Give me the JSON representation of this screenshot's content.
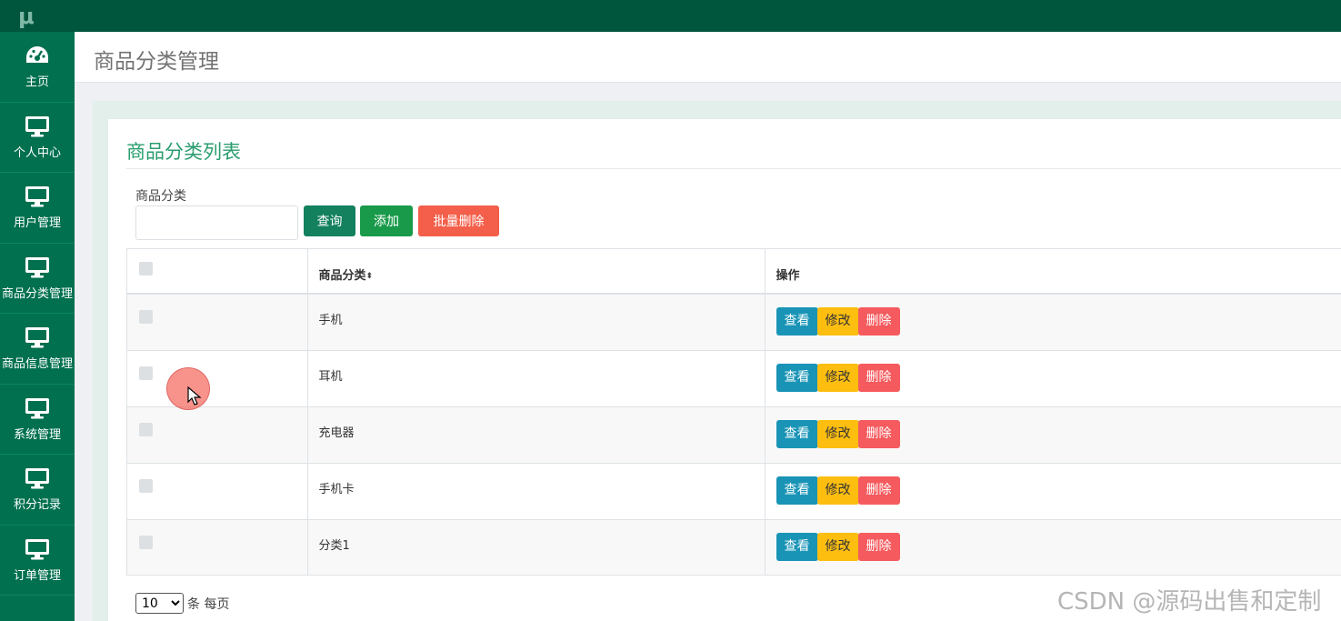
{
  "app": {
    "logo_text": "μ"
  },
  "sidebar": {
    "items": [
      {
        "label": "主页",
        "icon": "dashboard-icon"
      },
      {
        "label": "个人中心",
        "icon": "monitor-icon"
      },
      {
        "label": "用户管理",
        "icon": "monitor-icon"
      },
      {
        "label": "商品分类管理",
        "icon": "monitor-icon"
      },
      {
        "label": "商品信息管理",
        "icon": "monitor-icon"
      },
      {
        "label": "系统管理",
        "icon": "monitor-icon"
      },
      {
        "label": "积分记录",
        "icon": "monitor-icon"
      },
      {
        "label": "订单管理",
        "icon": "monitor-icon"
      }
    ]
  },
  "page": {
    "title": "商品分类管理"
  },
  "card": {
    "title": "商品分类列表"
  },
  "search": {
    "label": "商品分类",
    "value": "",
    "query_label": "查询",
    "add_label": "添加",
    "batch_delete_label": "批量删除"
  },
  "table": {
    "columns": [
      "",
      "商品分类",
      "操作"
    ],
    "sort_icon": "⬍",
    "rows": [
      {
        "category": "手机"
      },
      {
        "category": "耳机"
      },
      {
        "category": "充电器"
      },
      {
        "category": "手机卡"
      },
      {
        "category": "分类1"
      }
    ],
    "actions": {
      "view": "查看",
      "edit": "修改",
      "delete": "删除"
    }
  },
  "pager": {
    "page_size": "10",
    "page_size_options": [
      "10"
    ],
    "per_page_text": "条 每页"
  },
  "watermark": "CSDN @源码出售和定制",
  "colors": {
    "sidebar": "#00704f",
    "topbar": "#00553d",
    "accent": "#2a9d6e",
    "view_button": "#1994b6",
    "edit_button": "#fdbe10",
    "delete_button": "#f55b5e"
  }
}
